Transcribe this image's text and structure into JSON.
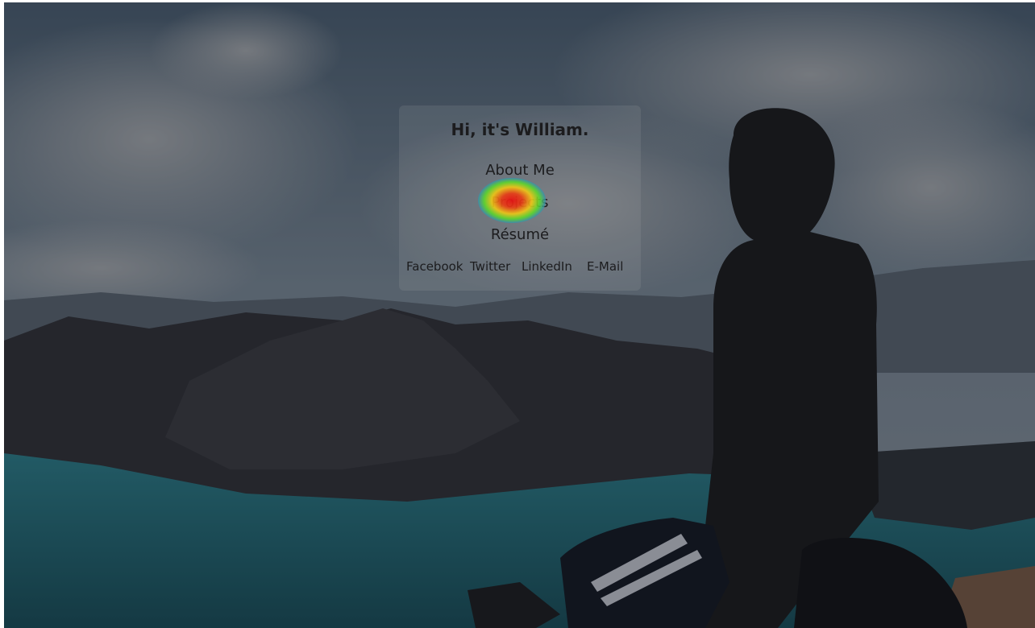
{
  "hero": {
    "title": "Hi, it's William.",
    "nav": {
      "about": "About Me",
      "projects": "Projects",
      "resume": "Résumé"
    },
    "social": {
      "facebook": "Facebook",
      "twitter": "Twitter",
      "linkedin": "LinkedIn",
      "email": "E-Mail"
    }
  },
  "colors": {
    "text": "#1c1c1e",
    "sky": "#6f8398",
    "lake": "#1f6f7a",
    "mountain": "#2e2f35"
  }
}
